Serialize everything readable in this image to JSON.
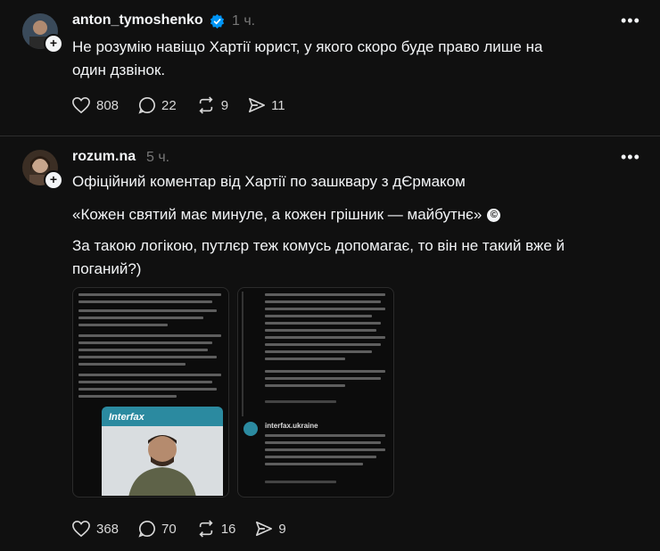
{
  "posts": [
    {
      "username": "anton_tymoshenko",
      "time": "1 ч.",
      "text": "Не розумію навіщо Хартії юрист, у якого скоро буде право лише на один дзвінок.",
      "likes": "808",
      "comments": "22",
      "reposts": "9",
      "shares": "11"
    },
    {
      "username": "rozum.na",
      "time": "5 ч.",
      "text_line1": "Офіційний коментар від Хартії по зашквару з дЄрмаком",
      "quote": "«Кожен святий має минуле, а кожен грішник — майбутнє»",
      "copyright_glyph": "©",
      "text_line3": "За такою логікою, путлєр теж комусь допомагає, то він не такий вже й поганий?)",
      "likes": "368",
      "comments": "70",
      "reposts": "16",
      "shares": "9",
      "embed_left": {
        "interfax_logo": "Interfax"
      },
      "embed_right": {
        "account": "interfax.ukraine"
      }
    }
  ],
  "icons": {
    "like": "heart-icon",
    "comment": "comment-icon",
    "repost": "repost-icon",
    "share": "send-icon",
    "more": "more-icon",
    "verified": "verified-badge-icon"
  },
  "colors": {
    "background": "#101010",
    "text": "#f3f5f7",
    "muted": "#777777",
    "verified": "#0095f6",
    "interfax_teal": "#2b8aa0"
  }
}
